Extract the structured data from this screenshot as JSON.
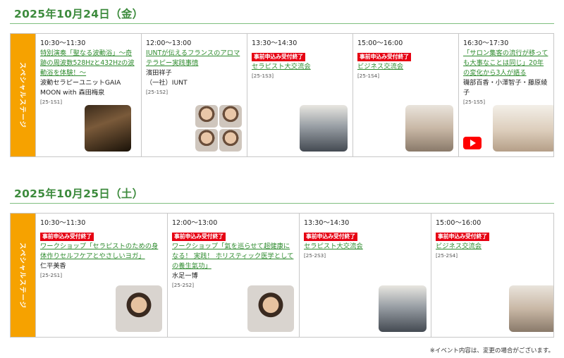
{
  "days": [
    {
      "date": "2025年10月24日（金）",
      "stage_label": "スペシャルステージ",
      "sessions": [
        {
          "time": "10:30〜11:30",
          "badge": "",
          "title": "特別演奏「聖なる波動浴」〜奇跡の周波数528Hzと432Hzの波動浴を体験！〜",
          "presenter": "波動セラピーユニットGAIA MOON with 森田梅泉",
          "code": "[25-1S1]"
        },
        {
          "time": "12:00〜13:00",
          "badge": "",
          "title": "IUNTが伝えるフランスのアロマテラピー実践事情",
          "presenter": "濱田祥子\n（一社）IUNT",
          "code": "[25-1S2]"
        },
        {
          "time": "13:30〜14:30",
          "badge": "事前申込み受付終了",
          "title": "セラピスト大交流会",
          "presenter": "",
          "code": "[25-1S3]"
        },
        {
          "time": "15:00〜16:00",
          "badge": "事前申込み受付終了",
          "title": "ビジネス交流会",
          "presenter": "",
          "code": "[25-1S4]"
        },
        {
          "time": "16:30〜17:30",
          "badge": "",
          "title": "「サロン集客の流行が移っても大事なことは同じ」20年の変化から3人が語る",
          "presenter": "磯部百香・小澤智子・藤原綾子",
          "code": "[25-1S5]"
        }
      ]
    },
    {
      "date": "2025年10月25日（土）",
      "stage_label": "スペシャルステージ",
      "sessions": [
        {
          "time": "10:30〜11:30",
          "badge": "事前申込み受付終了",
          "title": "ワークショップ「セラピストのための身体作りセルフケアとやさしいヨガ」",
          "presenter": "仁平美香",
          "code": "[25-2S1]"
        },
        {
          "time": "12:00〜13:00",
          "badge": "事前申込み受付終了",
          "title": "ワークショップ「氣を巡らせて超健康になる！ 実践！ ホリスティック医学としての養生氣功」",
          "presenter": "水足一博",
          "code": "[25-2S2]"
        },
        {
          "time": "13:30〜14:30",
          "badge": "事前申込み受付終了",
          "title": "セラピスト大交流会",
          "presenter": "",
          "code": "[25-2S3]"
        },
        {
          "time": "15:00〜16:00",
          "badge": "事前申込み受付終了",
          "title": "ビジネス交流会",
          "presenter": "",
          "code": "[25-2S4]"
        }
      ]
    }
  ],
  "footnote": "※イベント内容は、変更の場合がございます。",
  "colors": {
    "heading": "#3d8b3d",
    "stage": "#f6a200",
    "badge": "#e60012",
    "link": "#2e8b2e"
  }
}
